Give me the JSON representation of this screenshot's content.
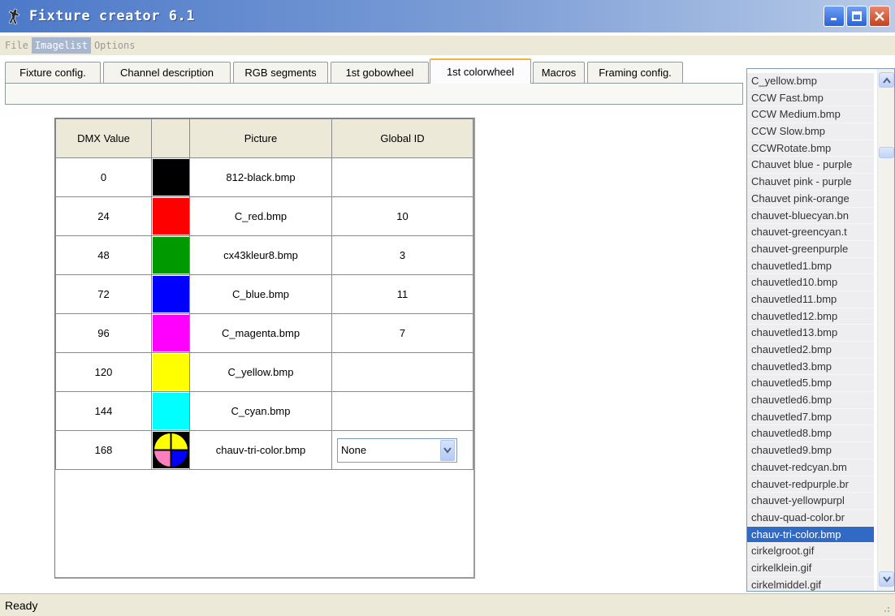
{
  "window": {
    "title": "Fixture creator 6.1"
  },
  "menu": [
    {
      "label": "File",
      "active": false
    },
    {
      "label": "Imagelist",
      "active": true
    },
    {
      "label": "Options",
      "active": false
    }
  ],
  "tabs": [
    {
      "label": "Fixture config.",
      "active": false
    },
    {
      "label": "Channel description",
      "active": false
    },
    {
      "label": "RGB segments",
      "active": false
    },
    {
      "label": "1st gobowheel",
      "active": false
    },
    {
      "label": "1st colorwheel",
      "active": true
    },
    {
      "label": "Macros",
      "active": false
    },
    {
      "label": "Framing config.",
      "active": false
    }
  ],
  "grid": {
    "headers": {
      "dmx": "DMX Value",
      "color": "",
      "picture": "Picture",
      "global_id": "Global ID"
    },
    "rows": [
      {
        "dmx": "0",
        "color": "#000000",
        "picture": "812-black.bmp",
        "global_id": ""
      },
      {
        "dmx": "24",
        "color": "#ff0000",
        "picture": "C_red.bmp",
        "global_id": "10"
      },
      {
        "dmx": "48",
        "color": "#009a00",
        "picture": "cx43kleur8.bmp",
        "global_id": "3"
      },
      {
        "dmx": "72",
        "color": "#0000ff",
        "picture": "C_blue.bmp",
        "global_id": "11"
      },
      {
        "dmx": "96",
        "color": "#ff00ff",
        "picture": "C_magenta.bmp",
        "global_id": "7"
      },
      {
        "dmx": "120",
        "color": "#ffff00",
        "picture": "C_yellow.bmp",
        "global_id": ""
      },
      {
        "dmx": "144",
        "color": "#00ffff",
        "picture": "C_cyan.bmp",
        "global_id": ""
      },
      {
        "dmx": "168",
        "color": "tri-color",
        "picture": "chauv-tri-color.bmp",
        "global_id": "",
        "global_id_select": "None"
      }
    ]
  },
  "imagelist": {
    "items": [
      "C_yellow.bmp",
      "CCW Fast.bmp",
      "CCW Medium.bmp",
      "CCW Slow.bmp",
      "CCWRotate.bmp",
      "Chauvet blue - purple",
      "Chauvet pink - purple",
      "Chauvet pink-orange",
      "chauvet-bluecyan.bn",
      "chauvet-greencyan.t",
      "chauvet-greenpurple",
      "chauvetled1.bmp",
      "chauvetled10.bmp",
      "chauvetled11.bmp",
      "chauvetled12.bmp",
      "chauvetled13.bmp",
      "chauvetled2.bmp",
      "chauvetled3.bmp",
      "chauvetled5.bmp",
      "chauvetled6.bmp",
      "chauvetled7.bmp",
      "chauvetled8.bmp",
      "chauvetled9.bmp",
      "chauvet-redcyan.bm",
      "chauvet-redpurple.br",
      "chauvet-yellowpurpl",
      "chauv-quad-color.br",
      "chauv-tri-color.bmp",
      "cirkelgroot.gif",
      "cirkelklein.gif",
      "cirkelmiddel.gif"
    ],
    "selected": "chauv-tri-color.bmp"
  },
  "status": {
    "text": "Ready"
  },
  "icons": {
    "app": "figure-app-icon",
    "minimize": "minimize-icon",
    "maximize": "maximize-icon",
    "close": "close-icon",
    "dropdown": "chevron-down-icon",
    "scroll_up": "scroll-up-icon",
    "scroll_down": "scroll-down-icon",
    "grip": "resize-grip-icon"
  }
}
